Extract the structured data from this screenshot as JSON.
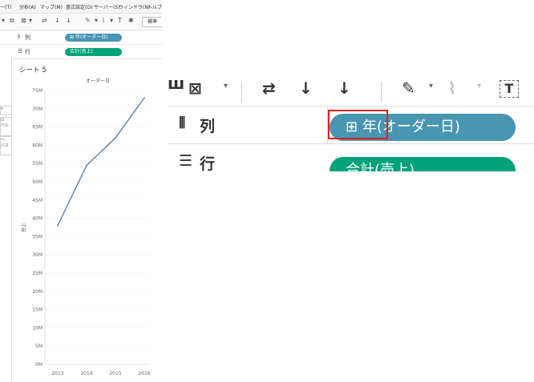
{
  "menubar": {
    "items": [
      "ー(T)",
      "分析(A)",
      "マップ(M)",
      "書式設定(O)",
      "サーバー(S)",
      "ウィンドウ(N)",
      "ヘルプ"
    ]
  },
  "toolbar": {
    "standard_label": "標準"
  },
  "shelves": {
    "columns": {
      "label": "列",
      "pill": "年(オーダー日)",
      "pill_icon": "⊞"
    },
    "rows": {
      "label": "行",
      "pill": "合計(売上)"
    }
  },
  "sheet": {
    "title": "シート 5"
  },
  "left_panel": {
    "items": [
      "ベル",
      "パス"
    ]
  },
  "chart_data": {
    "type": "line",
    "title": "オーダー日",
    "ylabel": "売上",
    "x": [
      "2013",
      "2014",
      "2015",
      "2016"
    ],
    "values": [
      38000000,
      54500000,
      62000000,
      73000000
    ],
    "yticks": [
      "0M",
      "5M",
      "10M",
      "15M",
      "20M",
      "25M",
      "30M",
      "35M",
      "40M",
      "45M",
      "50M",
      "55M",
      "60M",
      "65M",
      "70M",
      "75M"
    ],
    "ylim": [
      0,
      75000000
    ],
    "line_color": "#4e79a7",
    "grid": true
  },
  "zoom": {
    "columns_label": "列",
    "rows_label": "行",
    "columns_pill": "年(オーダー日)",
    "columns_pill_icon": "⊞",
    "rows_pill": "合計(売上)"
  },
  "colors": {
    "dimension_pill": "#4996b2",
    "measure_pill": "#00a27a",
    "highlight": "#e02020"
  }
}
